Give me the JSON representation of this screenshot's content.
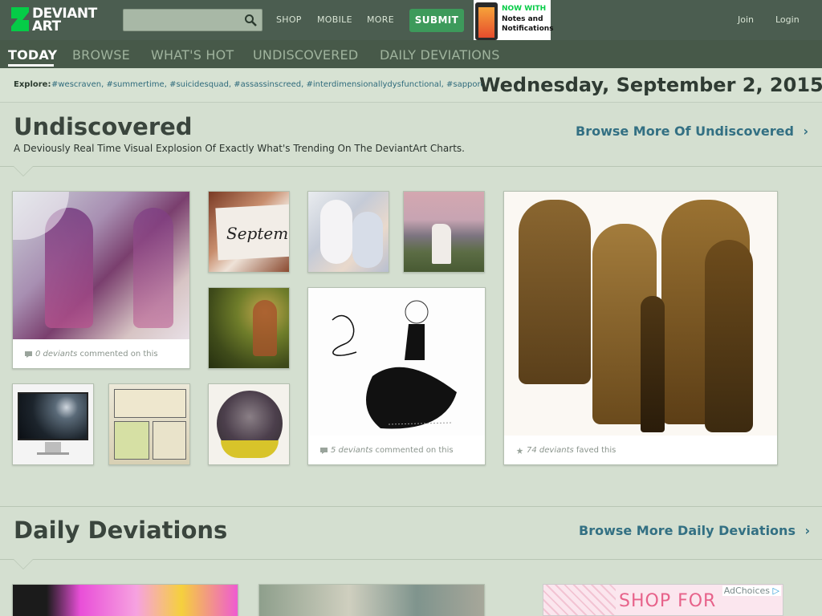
{
  "header": {
    "logo_text_line1": "DEVIANT",
    "logo_text_line2": "ART",
    "search_placeholder": "",
    "nav": [
      "SHOP",
      "MOBILE",
      "MORE"
    ],
    "submit_label": "SUBMIT",
    "promo_title": "NOW WITH",
    "promo_sub": "Notes and Notifications",
    "join_label": "Join",
    "login_label": "Login"
  },
  "tabs": [
    "TODAY",
    "BROWSE",
    "WHAT'S HOT",
    "UNDISCOVERED",
    "DAILY DEVIATIONS"
  ],
  "explore": {
    "label": "Explore:",
    "tags": [
      "#wescraven",
      "#summertime",
      "#suicidesquad",
      "#assassinscreed",
      "#interdimensionallydysfunctional",
      "#sapporo"
    ]
  },
  "date": "Wednesday, September 2, 2015",
  "undiscovered": {
    "title": "Undiscovered",
    "description": "A Deviously Real Time Visual Explosion Of Exactly What's Trending On The DeviantArt Charts.",
    "more_label": "Browse More Of Undiscovered",
    "captions": [
      {
        "count": "0 deviants",
        "suffix": "commented on this"
      },
      {
        "count": "5 deviants",
        "suffix": "commented on this"
      },
      {
        "count": "74 deviants",
        "suffix": "faved this"
      }
    ]
  },
  "daily": {
    "title": "Daily Deviations",
    "more_label": "Browse More Daily Deviations"
  },
  "ad": {
    "text": "SHOP FOR",
    "choices_label": "AdChoices"
  },
  "colors": {
    "accent_green": "#3d9a5b",
    "link_blue": "#337083",
    "header_bg": "#4b5d50"
  }
}
